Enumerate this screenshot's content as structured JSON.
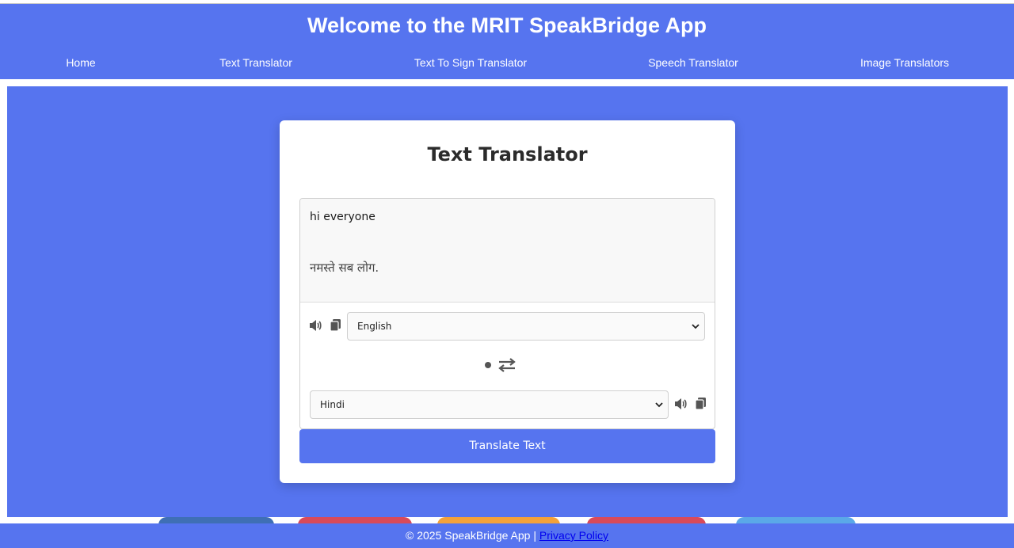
{
  "header": {
    "title": "Welcome to the MRIT SpeakBridge App",
    "nav": [
      {
        "label": "Home"
      },
      {
        "label": "Text Translator"
      },
      {
        "label": "Text To Sign Translator"
      },
      {
        "label": "Speech Translator"
      },
      {
        "label": "Image Translators"
      }
    ]
  },
  "translator": {
    "title": "Text Translator",
    "input_text": "hi everyone",
    "output_text": "नमस्ते सब लोग.",
    "source_language": "English",
    "target_language": "Hindi",
    "translate_label": "Translate Text",
    "icons": {
      "source_speak": "speaker-icon",
      "source_copy": "copy-icon",
      "swap": "swap-arrows-icon",
      "target_speak": "speaker-icon",
      "target_copy": "copy-icon"
    }
  },
  "footer": {
    "copyright": "© 2025 SpeakBridge App | ",
    "privacy_label": "Privacy Policy"
  },
  "colors": {
    "brand": "#5674ef",
    "card": "#ffffff",
    "text_dark": "#2b2b2b"
  }
}
